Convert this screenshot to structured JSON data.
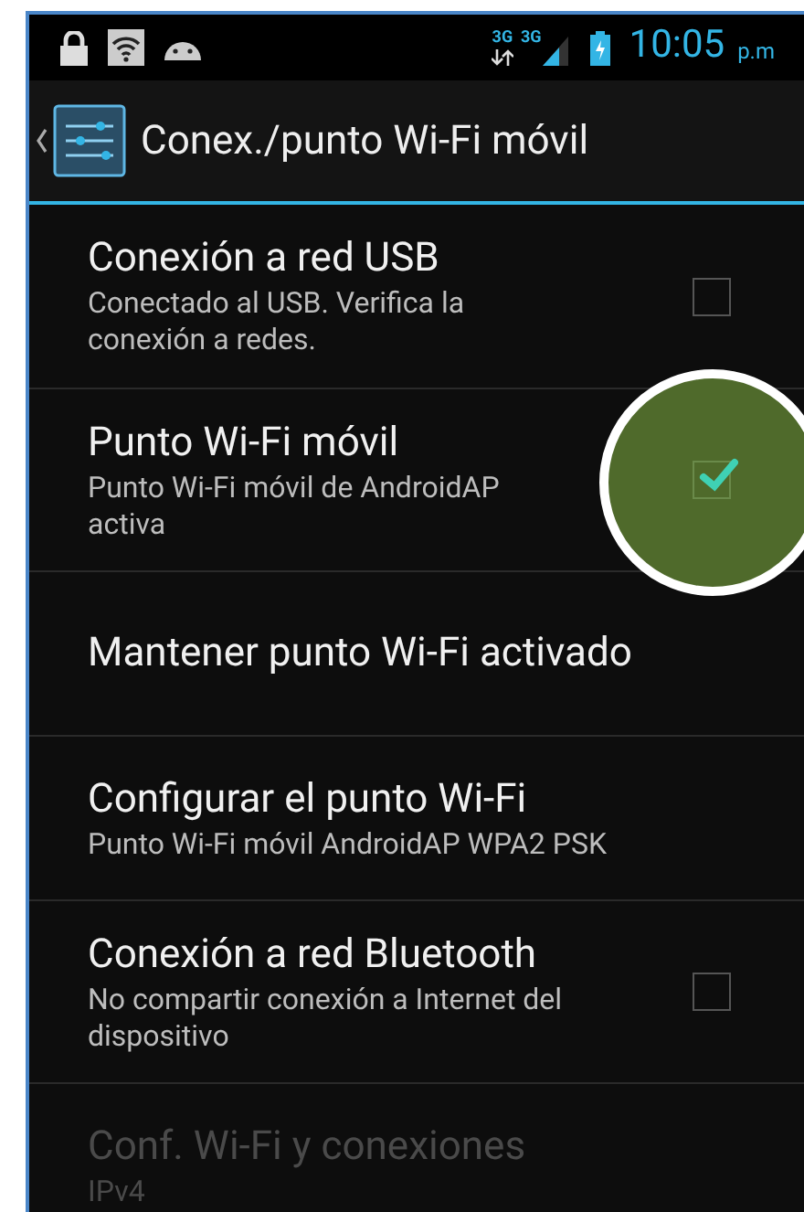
{
  "status_bar": {
    "network_labels": [
      "3G",
      "3G"
    ],
    "time": "10:05",
    "time_suffix": "p.m"
  },
  "action_bar": {
    "title": "Conex./punto Wi-Fi móvil"
  },
  "items": [
    {
      "kind": "checkbox",
      "title": "Conexión a red USB",
      "summary": "Conectado al USB. Verifica la conexión a redes.",
      "checked": false,
      "disabled": false
    },
    {
      "kind": "checkbox",
      "title": "Punto Wi-Fi móvil",
      "summary": "Punto Wi-Fi móvil de AndroidAP activa",
      "checked": true,
      "disabled": false
    },
    {
      "kind": "plain",
      "title": "Mantener punto Wi-Fi activado",
      "disabled": false
    },
    {
      "kind": "plain",
      "title": "Configurar el punto Wi-Fi",
      "summary": "Punto Wi-Fi móvil AndroidAP WPA2 PSK",
      "disabled": false
    },
    {
      "kind": "checkbox",
      "title": "Conexión a red Bluetooth",
      "summary": "No compartir conexión a Internet del dispositivo",
      "checked": false,
      "disabled": false
    },
    {
      "kind": "plain",
      "title": "Conf. Wi-Fi y conexiones",
      "summary": "IPv4",
      "disabled": true
    }
  ]
}
